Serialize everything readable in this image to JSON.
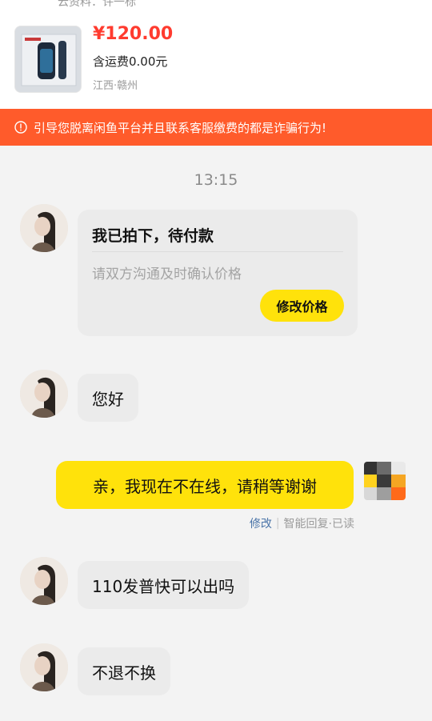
{
  "top_cut_text": "云资料：许一标",
  "product": {
    "price": "¥120.00",
    "shipping": "含运费0.00元",
    "location": "江西·赣州"
  },
  "warning": {
    "text": "引导您脱离闲鱼平台并且联系客服缴费的都是诈骗行为!",
    "icon": "info-circle-icon"
  },
  "chat": {
    "timestamp": "13:15",
    "order_card": {
      "title": "我已拍下，待付款",
      "subtitle": "请双方沟通及时确认价格",
      "button_label": "修改价格"
    },
    "messages": [
      {
        "from": "seller",
        "text": "您好"
      },
      {
        "from": "me",
        "text": "亲，我现在不在线，请稍等谢谢"
      },
      {
        "from": "seller",
        "text": "110发普快可以出吗"
      },
      {
        "from": "seller",
        "text": "不退不换"
      }
    ],
    "status": {
      "edit_label": "修改",
      "divider": "|",
      "auto_reply_label": "智能回复·已读"
    }
  },
  "colors": {
    "accent_yellow": "#ffe20b",
    "warning_orange": "#ff5b2b",
    "price_red": "#ff3b2f"
  }
}
